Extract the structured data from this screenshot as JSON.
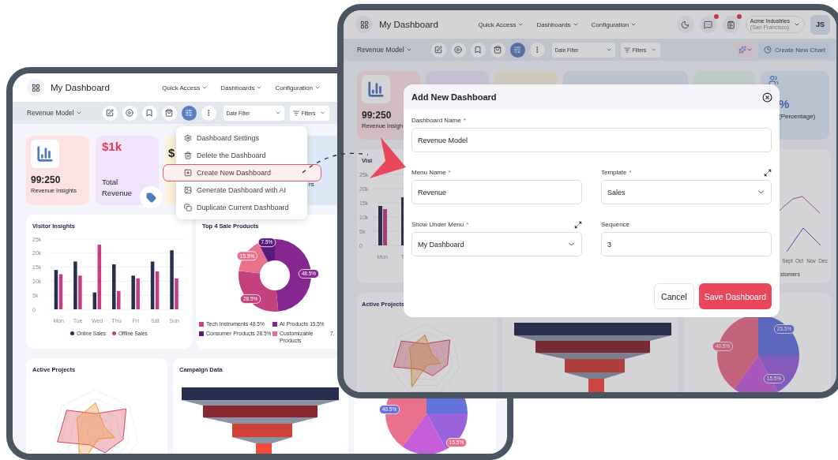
{
  "back_screen": {
    "header": {
      "title": "My Dashboard",
      "nav": [
        "Quick Access",
        "Dashboards",
        "Configuration"
      ]
    },
    "toolbar": {
      "model": "Revenue Model",
      "tools": [
        {
          "kind": "edit",
          "selected": false
        },
        {
          "kind": "play",
          "selected": false
        },
        {
          "kind": "bookmark",
          "selected": false
        },
        {
          "kind": "bag",
          "selected": false
        },
        {
          "kind": "sliders",
          "selected": true
        },
        {
          "kind": "more",
          "selected": false
        }
      ],
      "date_filter": "Date Filter",
      "filters": "Filters"
    },
    "menu": [
      {
        "kind": "settings",
        "label": "Dashboard Settings",
        "selected": false
      },
      {
        "kind": "delete",
        "label": "Delete the Dashboard",
        "selected": false
      },
      {
        "kind": "add",
        "label": "Create New Dashboard",
        "selected": true
      },
      {
        "kind": "ai",
        "label": "Generate Dashboard with AI",
        "selected": false
      },
      {
        "kind": "duplicate",
        "label": "Duplicate Current Dashboard",
        "selected": false
      }
    ],
    "kpis": [
      {
        "kind": "icon",
        "value": "99:250",
        "label": "Revenue Insights",
        "color": "#fde2e4"
      },
      {
        "kind": "tag",
        "value": "$1k",
        "label": "Total Revenue",
        "color": "#efe4fb"
      },
      {
        "kind": "plain",
        "value": "$",
        "color": "#fdf0d9"
      },
      {
        "kind": "plain",
        "label": "rs",
        "color": "#dce8f6"
      }
    ],
    "visitor_insights": {
      "title": "Visitor Insights",
      "chart_data": {
        "type": "bar",
        "categories": [
          "Mon",
          "Tue",
          "Wed",
          "Thu",
          "Fri",
          "Sat",
          "Sun"
        ],
        "series": [
          {
            "name": "Online Sales",
            "color": "#262d4d",
            "values": [
              14,
              17,
              6,
              16,
              12,
              17,
              21
            ]
          },
          {
            "name": "Offline Sales",
            "color": "#c73d82",
            "values": [
              12.5,
              12,
              23,
              6.5,
              11,
              13.5,
              11
            ]
          }
        ],
        "ylim": [
          0,
          25
        ],
        "grid": true,
        "yticks": [
          {
            "value": 0,
            "label": "0"
          },
          {
            "value": 5,
            "label": "5k"
          },
          {
            "value": 10,
            "label": "10k"
          },
          {
            "value": 15,
            "label": "15k"
          },
          {
            "value": 20,
            "label": "20k"
          },
          {
            "value": 25,
            "label": "25k"
          }
        ]
      }
    },
    "top_products": {
      "title": "Top 4 Sale Products",
      "chart_data": {
        "type": "donut",
        "values": [
          48.5,
          28.5,
          15.5,
          7.5
        ],
        "value_labels": [
          "48.5%",
          "28.5%",
          "15.5%",
          "7.5%"
        ]
      },
      "legend": [
        {
          "label": "Tech Instruments",
          "value": "48.5%",
          "color": "#c4407f"
        },
        {
          "label": "AI Products",
          "value": "15.5%",
          "color": "#86268f"
        },
        {
          "label": "Consumer Products",
          "value": "28.5%",
          "color": "#5a1a7c"
        },
        {
          "label": "Customizable Products",
          "value": "7.",
          "color": "#e9718b"
        }
      ]
    },
    "active_projects": {
      "title": "Active Projects"
    },
    "campaign": {
      "title": "Campaign Data"
    },
    "pie": {
      "labels": [
        "40.5%",
        "15.5%"
      ]
    }
  },
  "front_screen": {
    "header": {
      "title": "My Dashboard",
      "nav": [
        "Quick Access",
        "Dashboards",
        "Configuration"
      ],
      "company": "Acme Industries",
      "location": "(San Francisco)",
      "avatar": "JS"
    },
    "toolbar": {
      "model": "Revenue Model",
      "tools": [
        {
          "kind": "edit",
          "selected": false
        },
        {
          "kind": "play",
          "selected": false
        },
        {
          "kind": "bookmark",
          "selected": false
        },
        {
          "kind": "bag",
          "selected": false
        },
        {
          "kind": "sliders",
          "selected": true
        },
        {
          "kind": "more",
          "selected": false
        }
      ],
      "date_filter": "Date Filter",
      "filters": "Filters",
      "create_chart": "Create New Chart"
    },
    "kpis": [
      {
        "kind": "icon",
        "value": "99:250",
        "label": "Revenue Insigh"
      },
      {
        "kind": "plain"
      },
      {
        "kind": "plain"
      },
      {
        "kind": "plain"
      },
      {
        "kind": "plain"
      },
      {
        "kind": "users",
        "value": "%",
        "label": "(Percentage)"
      }
    ],
    "visitor": {
      "title": "Visi",
      "yticks": [
        "25k",
        "20k",
        "15k",
        "10k",
        "5k",
        "0"
      ],
      "xlabels": [
        "Mon",
        "T"
      ]
    },
    "customers": {
      "months": [
        "Sept",
        "Oct",
        "Nov",
        "Dec"
      ],
      "caption": "stomers"
    },
    "active_projects": {
      "title": "Active Projects"
    },
    "pie": {
      "labels": [
        "25.5%",
        "40.5%",
        "15.5%"
      ]
    },
    "modal": {
      "title": "Add New Dashboard",
      "rows": [
        [
          {
            "label": "Dashboard Name",
            "required_mark": "*",
            "kind": "text",
            "value": "Revenue Model",
            "action_icon": false
          }
        ],
        [
          {
            "label": "Menu Name",
            "required_mark": "*",
            "kind": "text",
            "value": "Revenue",
            "action_icon": false
          },
          {
            "label": "Template",
            "required_mark": "*",
            "kind": "select",
            "value": "Sales",
            "action_icon": true
          }
        ],
        [
          {
            "label": "Show Under Menu",
            "required_mark": "*",
            "kind": "select",
            "value": "My Dashboard",
            "action_icon": true
          },
          {
            "label": "Sequence",
            "kind": "text",
            "value": "3",
            "action_icon": false
          }
        ]
      ],
      "cancel": "Cancel",
      "save": "Save Dashboard"
    }
  }
}
